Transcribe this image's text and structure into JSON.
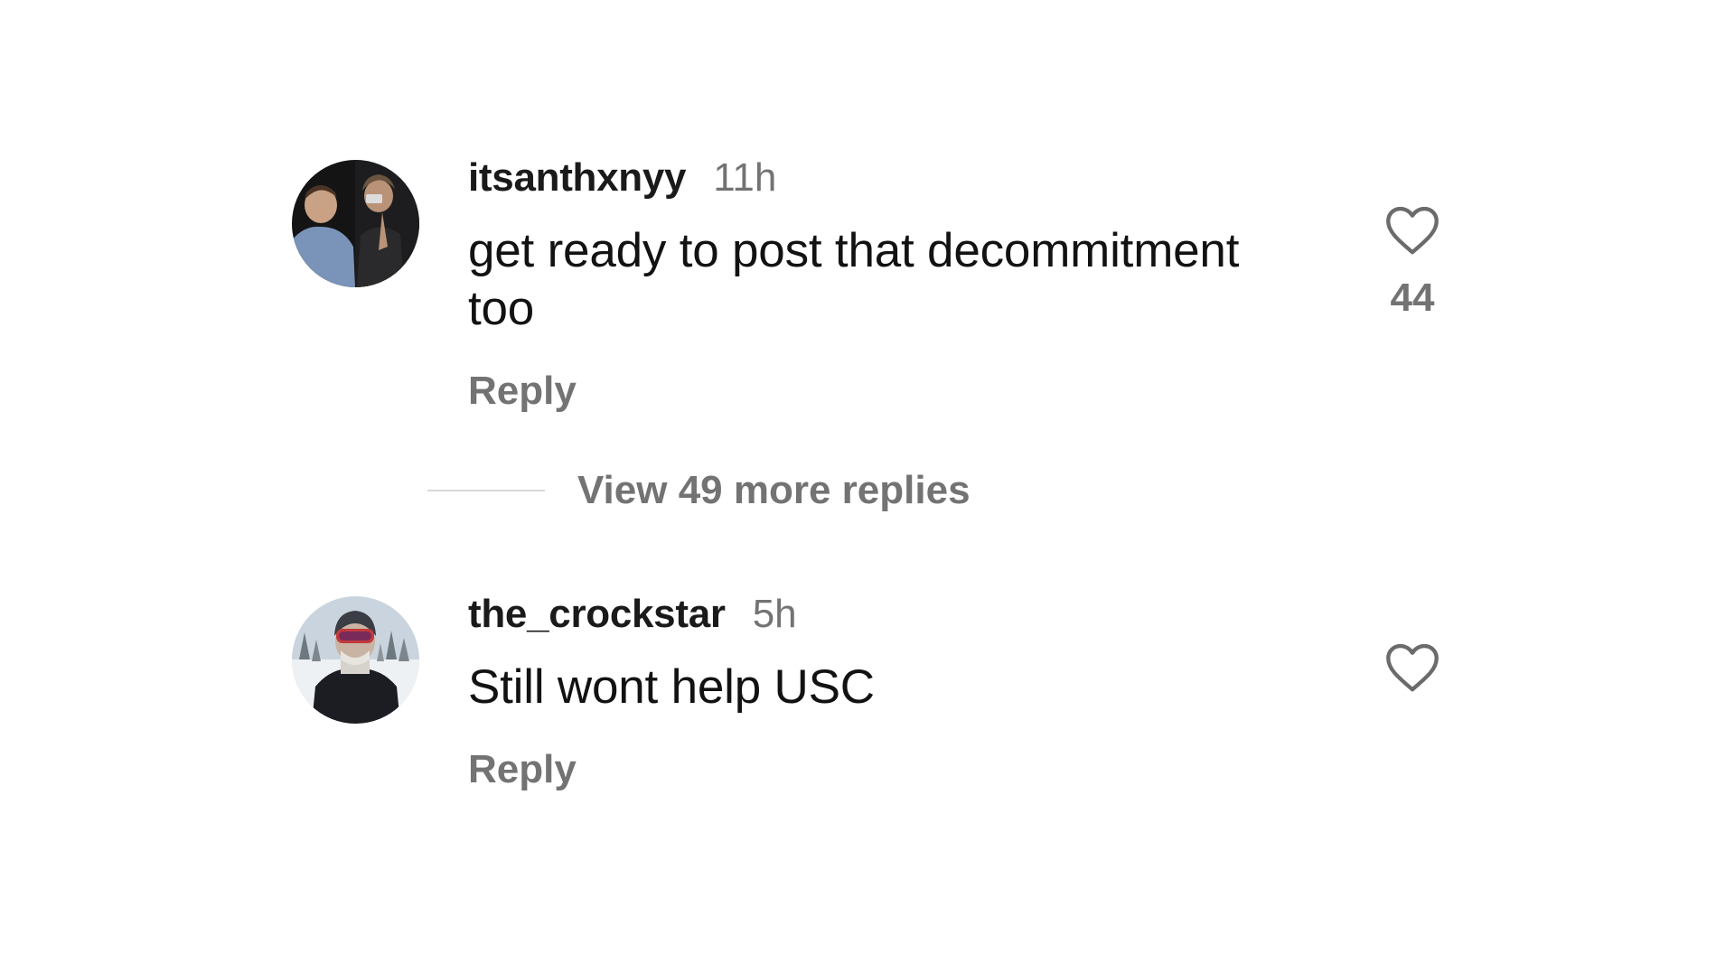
{
  "comments": [
    {
      "username": "itsanthxnyy",
      "time": "11h",
      "text": "get ready to post that decommitment too",
      "reply_label": "Reply",
      "like_count": "44",
      "avatar_icon": "profile-photo-two-people-dark"
    },
    {
      "username": "the_crockstar",
      "time": "5h",
      "text": "Still wont help USC",
      "reply_label": "Reply",
      "like_count": "",
      "avatar_icon": "profile-photo-skier-goggles"
    }
  ],
  "view_replies": {
    "label": "View 49 more replies"
  },
  "colors": {
    "username": "#1a1a1a",
    "secondary_text": "#737373",
    "divider": "#d9d9d9",
    "background": "#ffffff"
  }
}
